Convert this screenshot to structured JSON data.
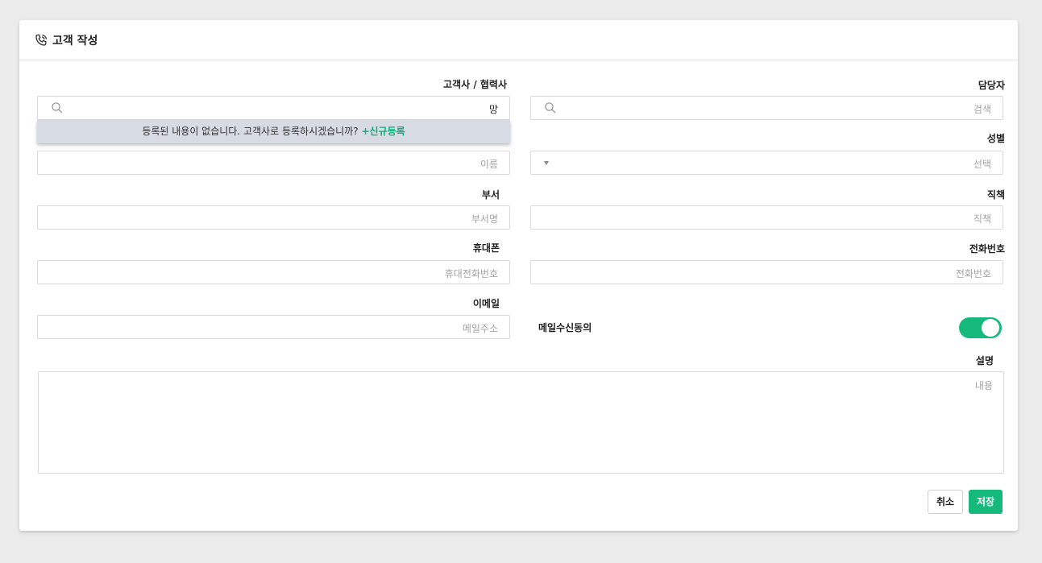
{
  "header": {
    "title": "고객 작성",
    "icon": "phone-icon"
  },
  "form": {
    "company": {
      "label": "고객사 / 협력사",
      "value": "망"
    },
    "manager": {
      "label": "담당자",
      "placeholder": "검색"
    },
    "name": {
      "placeholder": "이름"
    },
    "gender": {
      "label": "성별",
      "placeholder": "선택"
    },
    "department": {
      "label": "부서",
      "placeholder": "부서명"
    },
    "position": {
      "label": "직책",
      "placeholder": "직책"
    },
    "mobile": {
      "label": "휴대폰",
      "placeholder": "휴대전화번호"
    },
    "phone": {
      "label": "전화번호",
      "placeholder": "전화번호"
    },
    "email": {
      "label": "이메일",
      "placeholder": "메일주소"
    },
    "email_consent": {
      "label": "메일수신동의",
      "enabled": true
    },
    "description": {
      "label": "설명",
      "placeholder": "내용"
    }
  },
  "dropdown": {
    "message": "등록된 내용이 없습니다. 고객사로 등록하시겠습니까? ",
    "new_link": "+신규등록"
  },
  "buttons": {
    "cancel": "취소",
    "save": "저장"
  },
  "colors": {
    "accent": "#14b97b",
    "dropdown_bg": "#d7dbe3"
  }
}
